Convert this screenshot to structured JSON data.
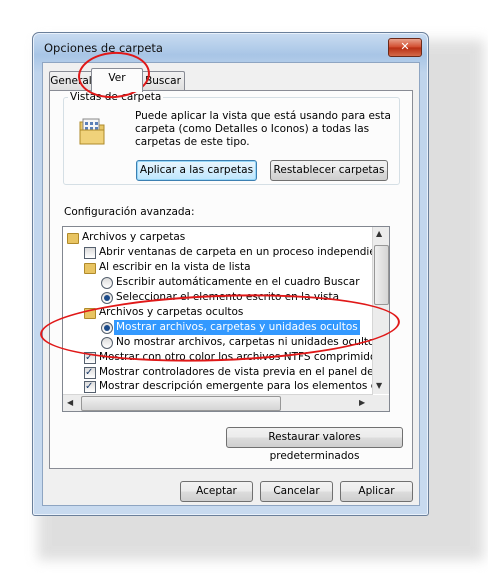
{
  "dialog": {
    "title": "Opciones de carpeta",
    "close_symbol": "✕",
    "tabs": [
      {
        "label": "General",
        "active": false
      },
      {
        "label": "Ver",
        "active": true
      },
      {
        "label": "Buscar",
        "active": false
      }
    ]
  },
  "folder_views": {
    "caption": "Vistas de carpeta",
    "description": "Puede aplicar la vista que está usando para esta carpeta (como Detalles o Iconos) a todas las carpetas de este tipo.",
    "apply_button": "Aplicar a las carpetas",
    "reset_button": "Restablecer carpetas"
  },
  "advanced": {
    "caption": "Configuración avanzada:",
    "items": [
      {
        "type": "folder",
        "indent": 0,
        "label": "Archivos y carpetas"
      },
      {
        "type": "checkbox",
        "indent": 1,
        "checked": false,
        "label": "Abrir ventanas de carpeta  en un proceso independiente"
      },
      {
        "type": "folder",
        "indent": 1,
        "label": "Al escribir en la vista de lista"
      },
      {
        "type": "radio",
        "indent": 2,
        "checked": false,
        "label": "Escribir automáticamente en el cuadro Buscar"
      },
      {
        "type": "radio",
        "indent": 2,
        "checked": true,
        "label": "Seleccionar el elemento escrito en la vista"
      },
      {
        "type": "folder",
        "indent": 1,
        "label": "Archivos y carpetas ocultos"
      },
      {
        "type": "radio",
        "indent": 2,
        "checked": true,
        "selected": true,
        "label": "Mostrar archivos, carpetas y unidades ocultos"
      },
      {
        "type": "radio",
        "indent": 2,
        "checked": false,
        "label": "No mostrar archivos, carpetas ni unidades ocultos"
      },
      {
        "type": "checkbox",
        "indent": 1,
        "checked": true,
        "label": "Mostrar con otro color los archivos NTFS comprimidos o c"
      },
      {
        "type": "checkbox",
        "indent": 1,
        "checked": true,
        "label": "Mostrar controladores de vista previa en el panel de vista"
      },
      {
        "type": "checkbox",
        "indent": 1,
        "checked": true,
        "label": "Mostrar descripción emergente para los elementos de car"
      }
    ],
    "restore_button": "Restaurar valores predeterminados"
  },
  "footer": {
    "ok": "Aceptar",
    "cancel": "Cancelar",
    "apply": "Aplicar"
  },
  "colors": {
    "selection": "#3399ff",
    "annotation": "#e01818"
  }
}
